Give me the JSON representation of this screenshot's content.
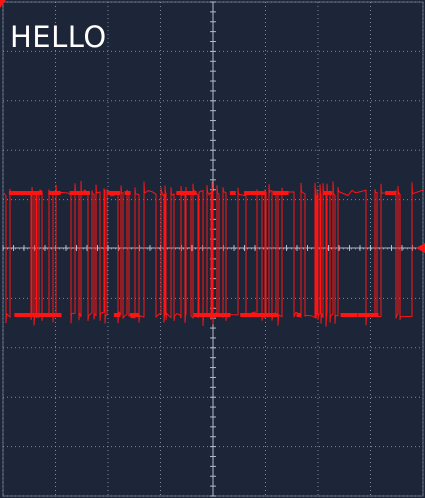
{
  "display": {
    "label": "HELLO",
    "background_color": "#1c2638",
    "grid_color": "#8f9aae",
    "axis_color": "#c4cad6",
    "trace_color": "#ff1414",
    "marker_color": "#ff1414",
    "label_color": "#ffffff",
    "icons": [
      "trigger-level-marker-icon",
      "corner-marker-icon"
    ]
  }
}
